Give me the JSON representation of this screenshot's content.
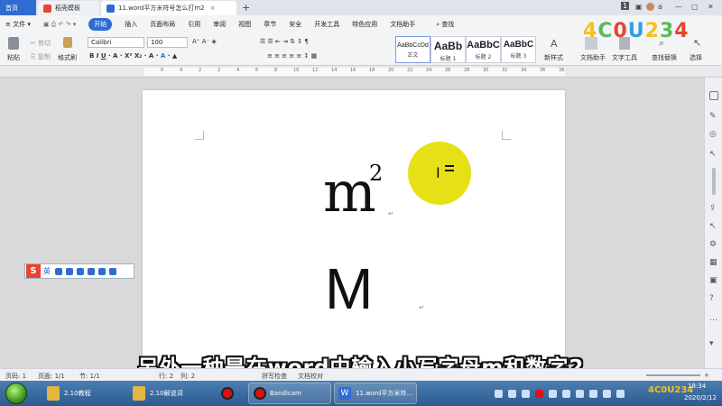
{
  "tabs": [
    {
      "label": "首页"
    },
    {
      "label": "稻壳模板"
    },
    {
      "label": "11.word平方米符号怎么打m2"
    }
  ],
  "window": {
    "badge": "1",
    "user": "a"
  },
  "menu": {
    "file": "文件",
    "items": [
      "开始",
      "插入",
      "页面布局",
      "引用",
      "审阅",
      "视图",
      "章节",
      "安全",
      "开发工具",
      "特色应用",
      "文档助手"
    ],
    "search": "查找"
  },
  "ribbon": {
    "paste": "粘贴",
    "cut": "剪切",
    "copy": "复制",
    "format_painter": "格式刷",
    "font_name": "Calibri",
    "font_size": "100",
    "styles": [
      {
        "sample": "AaBbCcDd",
        "name": "正文"
      },
      {
        "sample": "AaBb",
        "name": "标题 1"
      },
      {
        "sample": "AaBbC",
        "name": "标题 2"
      },
      {
        "sample": "AaBbC",
        "name": "标题 3"
      }
    ],
    "new_style": "新样式",
    "doc_helper": "文档助手",
    "text_tool": "文字工具",
    "find_replace": "查找替换",
    "select": "选择"
  },
  "ruler_ticks": [
    "6",
    "4",
    "2",
    "2",
    "4",
    "6",
    "8",
    "10",
    "12",
    "14",
    "16",
    "18",
    "20",
    "22",
    "24",
    "26",
    "28",
    "30",
    "32",
    "34",
    "36",
    "38"
  ],
  "document": {
    "line1_base": "m",
    "line1_sup": "2",
    "line2": "M"
  },
  "ime": {
    "logo": "S",
    "mode": "英"
  },
  "subtitle": "另外一种是在word中输入小写字母m和数字2",
  "status": {
    "page_num": "页码: 1",
    "pages": "页面: 1/1",
    "section": "节: 1/1",
    "line": "行: 2",
    "column": "列: 2",
    "spell": "拼写检查",
    "doc_check": "文档校对"
  },
  "taskbar": {
    "items": [
      "2.10教程",
      "2.10解说词",
      "Bandicam",
      "11.word平方米符..."
    ],
    "time": "18:34",
    "date": "2020/2/12"
  },
  "watermark": "4C0U234",
  "colors": {
    "accent": "#2f6cd1",
    "highlight": "#e6e116",
    "taskbar": "#3a6ea5"
  }
}
